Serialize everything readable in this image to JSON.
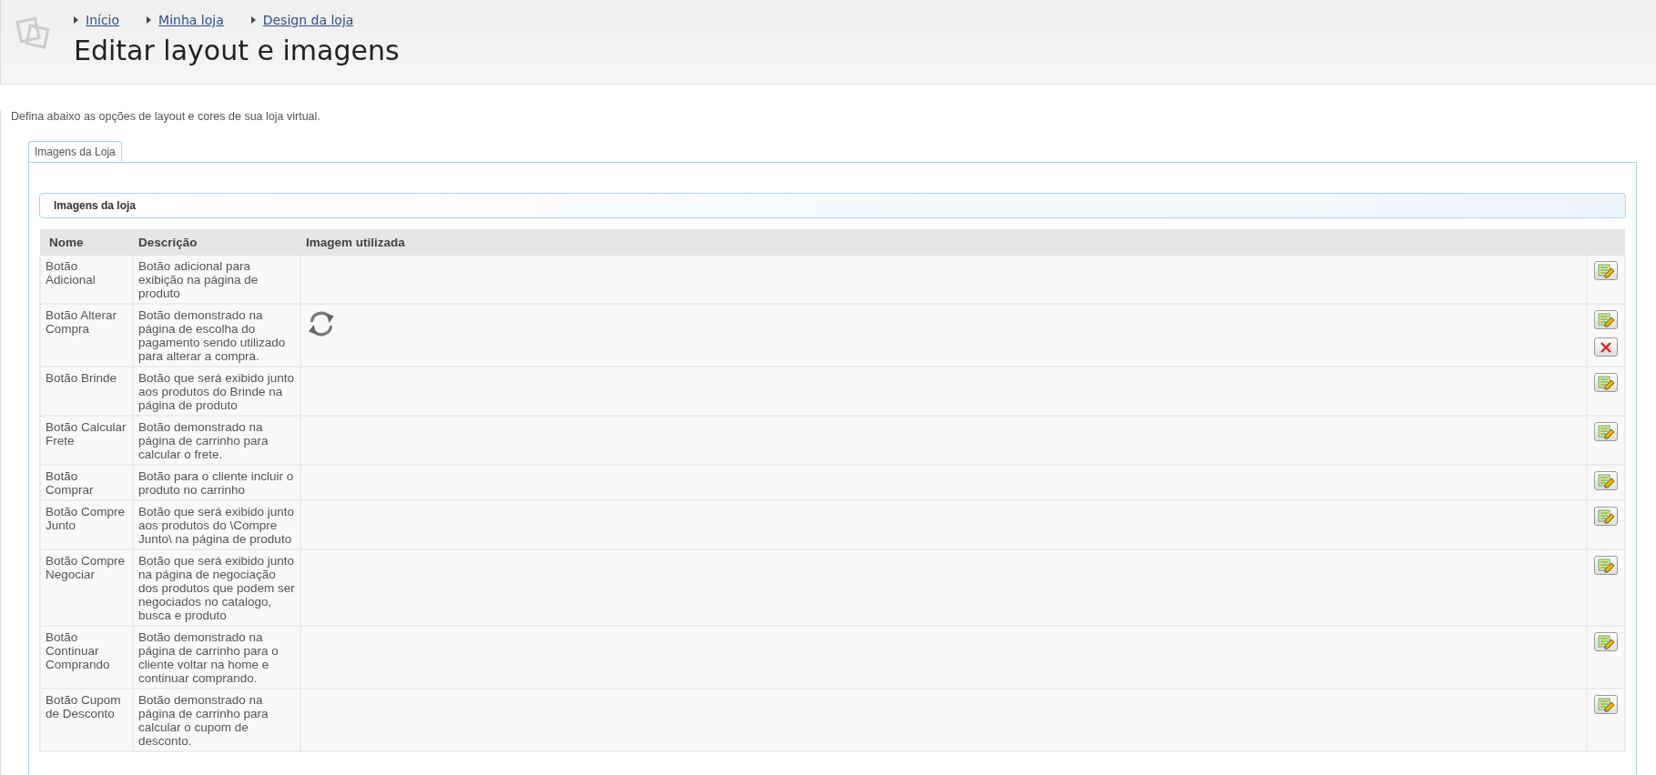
{
  "breadcrumbs": [
    "Início",
    "Minha loja",
    "Design da loja"
  ],
  "title": "Editar layout e imagens",
  "intro": "Defina abaixo as opções de layout e cores de sua loja virtual.",
  "tabs": [
    {
      "label": "Imagens da Loja",
      "selected": true
    }
  ],
  "section": {
    "title": "Imagens da loja"
  },
  "table": {
    "columns": [
      "Nome",
      "Descrição",
      "Imagem utilizada"
    ],
    "rows": [
      {
        "name": "Botão Adicional",
        "description": "Botão adicional para exibição na página de produto",
        "image_set": false
      },
      {
        "name": "Botão Alterar Compra",
        "description": "Botão demonstrado na página de escolha do pagamento sendo utilizado para alterar a compra.",
        "image_set": true
      },
      {
        "name": "Botão Brinde",
        "description": "Botão que será exibido junto aos produtos do Brinde na página de produto",
        "image_set": false
      },
      {
        "name": "Botão Calcular Frete",
        "description": "Botão demonstrado na página de carrinho para calcular o frete.",
        "image_set": false
      },
      {
        "name": "Botão Comprar",
        "description": "Botão para o cliente incluir o produto no carrinho",
        "image_set": false
      },
      {
        "name": "Botão Compre Junto",
        "description": "Botão que será exibido junto aos produtos do \\Compre Junto\\ na página de produto",
        "image_set": false
      },
      {
        "name": "Botão Compre Negociar",
        "description": "Botão que será exibido junto na página de negociação dos produtos que podem ser negociados no catalogo, busca e produto",
        "image_set": false
      },
      {
        "name": "Botão Continuar Comprando",
        "description": "Botão demonstrado na página de carrinho para o cliente voltar na home e continuar comprando.",
        "image_set": false
      },
      {
        "name": "Botão Cupom de Desconto",
        "description": "Botão demonstrado na página de carrinho para calcular o cupom de desconto.",
        "image_set": false
      }
    ]
  }
}
